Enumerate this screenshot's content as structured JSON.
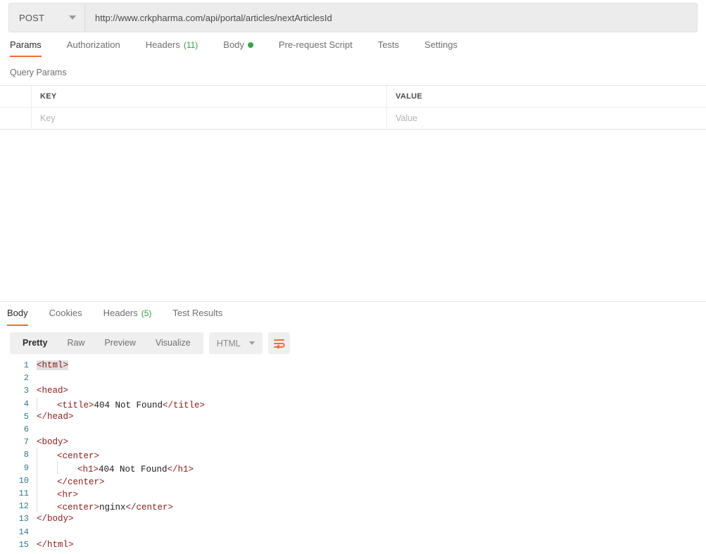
{
  "request": {
    "method": {
      "value": "POST",
      "icon": "chevron-down-icon"
    },
    "url": {
      "value": "http://www.crkpharma.com/api/portal/articles/nextArticlesId"
    },
    "tabs": [
      {
        "label": "Params",
        "active": true
      },
      {
        "label": "Authorization",
        "active": false
      },
      {
        "label": "Headers",
        "count": "(11)",
        "active": false
      },
      {
        "label": "Body",
        "indicator": "dot-green",
        "active": false
      },
      {
        "label": "Pre-request Script",
        "active": false
      },
      {
        "label": "Tests",
        "active": false
      },
      {
        "label": "Settings",
        "active": false
      }
    ],
    "params": {
      "section_title": "Query Params",
      "columns": [
        "KEY",
        "VALUE"
      ],
      "rows": [
        {
          "key_placeholder": "Key",
          "value_placeholder": "Value"
        }
      ]
    }
  },
  "response": {
    "tabs": [
      {
        "label": "Body",
        "active": true
      },
      {
        "label": "Cookies",
        "active": false
      },
      {
        "label": "Headers",
        "count": "(5)",
        "active": false
      },
      {
        "label": "Test Results",
        "active": false
      }
    ],
    "view_modes": [
      {
        "label": "Pretty",
        "active": true
      },
      {
        "label": "Raw",
        "active": false
      },
      {
        "label": "Preview",
        "active": false
      },
      {
        "label": "Visualize",
        "active": false
      }
    ],
    "format": {
      "label": "HTML",
      "icon": "chevron-down-icon"
    },
    "wrap_button": {
      "icon": "word-wrap-icon"
    },
    "body_lines": [
      {
        "n": "1",
        "indent": 0,
        "parts": [
          {
            "t": "tag",
            "s": "<html>",
            "match": true
          }
        ]
      },
      {
        "n": "2",
        "indent": 0,
        "parts": []
      },
      {
        "n": "3",
        "indent": 0,
        "parts": [
          {
            "t": "tag",
            "s": "<head>"
          }
        ]
      },
      {
        "n": "4",
        "indent": 1,
        "parts": [
          {
            "t": "tag",
            "s": "<title>"
          },
          {
            "t": "txt",
            "s": "404 Not Found"
          },
          {
            "t": "tag",
            "s": "</title>"
          }
        ]
      },
      {
        "n": "5",
        "indent": 0,
        "parts": [
          {
            "t": "tag",
            "s": "</head>"
          }
        ]
      },
      {
        "n": "6",
        "indent": 0,
        "parts": []
      },
      {
        "n": "7",
        "indent": 0,
        "parts": [
          {
            "t": "tag",
            "s": "<body>"
          }
        ]
      },
      {
        "n": "8",
        "indent": 1,
        "parts": [
          {
            "t": "tag",
            "s": "<center>"
          }
        ]
      },
      {
        "n": "9",
        "indent": 2,
        "parts": [
          {
            "t": "tag",
            "s": "<h1>"
          },
          {
            "t": "txt",
            "s": "404 Not Found"
          },
          {
            "t": "tag",
            "s": "</h1>"
          }
        ]
      },
      {
        "n": "10",
        "indent": 1,
        "parts": [
          {
            "t": "tag",
            "s": "</center>"
          }
        ]
      },
      {
        "n": "11",
        "indent": 1,
        "parts": [
          {
            "t": "tag",
            "s": "<hr>"
          }
        ]
      },
      {
        "n": "12",
        "indent": 1,
        "parts": [
          {
            "t": "tag",
            "s": "<center>"
          },
          {
            "t": "txt",
            "s": "nginx"
          },
          {
            "t": "tag",
            "s": "</center>"
          }
        ]
      },
      {
        "n": "13",
        "indent": 0,
        "parts": [
          {
            "t": "tag",
            "s": "</body>"
          }
        ]
      },
      {
        "n": "14",
        "indent": 0,
        "parts": []
      },
      {
        "n": "15",
        "indent": 0,
        "parts": [
          {
            "t": "tag",
            "s": "</html>"
          }
        ]
      }
    ]
  },
  "colors": {
    "accent_orange": "#ef6c33",
    "status_green": "#33a544",
    "tag_red": "#8b1a1a",
    "line_number": "#2f7c8c",
    "toolbar_grey": "#efefef"
  }
}
